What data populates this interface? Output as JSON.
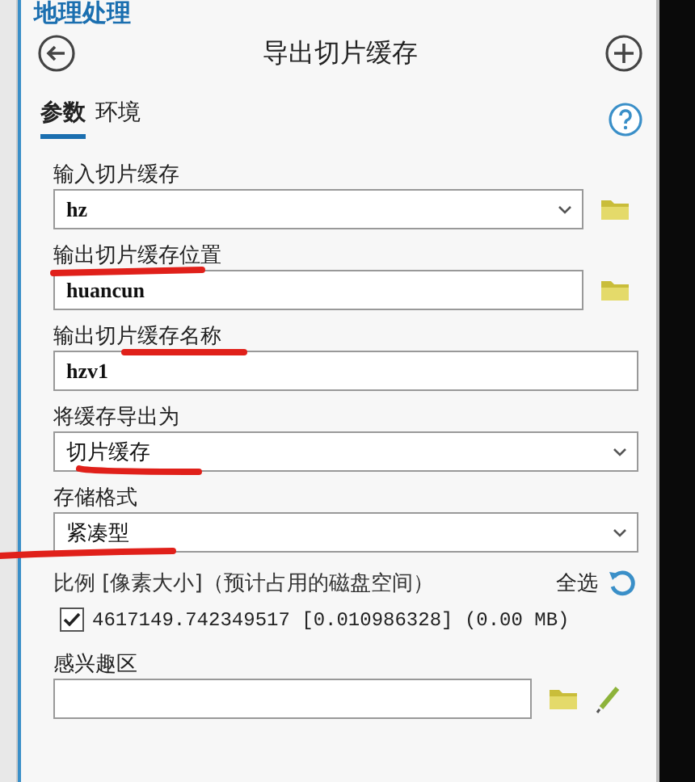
{
  "window": {
    "title": "地理处理"
  },
  "header": {
    "title": "导出切片缓存"
  },
  "tabs": [
    {
      "label": "参数",
      "selected": true
    },
    {
      "label": "环境",
      "selected": false
    }
  ],
  "parameters": [
    {
      "kind": "dropdown",
      "label": "输入切片缓存",
      "value": "hz",
      "browse": true
    },
    {
      "kind": "text",
      "label": "输出切片缓存位置",
      "value": "huancun",
      "browse": true
    },
    {
      "kind": "text",
      "label": "输出切片缓存名称",
      "value": "hzv1",
      "browse": false
    },
    {
      "kind": "dropdown",
      "label": "将缓存导出为",
      "value": "切片缓存",
      "browse": false
    },
    {
      "kind": "dropdown",
      "label": "存储格式",
      "value": "紧凑型",
      "browse": false
    }
  ],
  "scales": {
    "label": "比例 [像素大小]（预计占用的磁盘空间）",
    "select_all": "全选",
    "items": [
      {
        "text": "4617149.742349517 [0.010986328] (0.00 MB)",
        "checked": true
      }
    ]
  },
  "aoi": {
    "label": "感兴趣区"
  }
}
